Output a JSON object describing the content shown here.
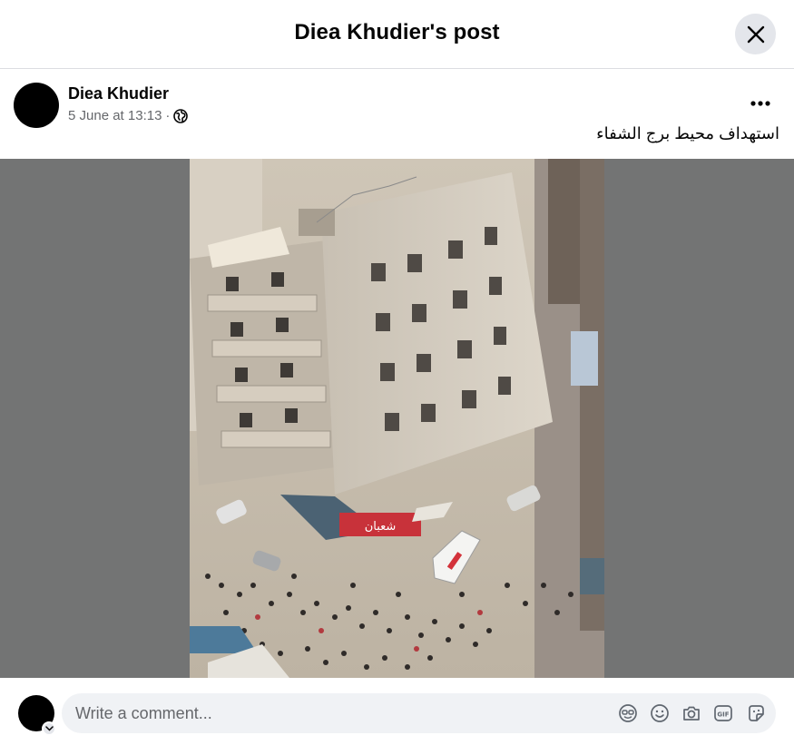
{
  "dialog": {
    "title": "Diea Khudier's post"
  },
  "post": {
    "author": "Diea Khudier",
    "timestamp": "5 June at 13:13",
    "separator": "·",
    "privacy_icon": "globe-icon",
    "caption": "استهداف محيط برج الشفاء",
    "more_icon": "more-options-icon"
  },
  "comment": {
    "placeholder": "Write a comment...",
    "icons": [
      "avatar-sticker-icon",
      "emoji-icon",
      "camera-icon",
      "gif-icon",
      "sticker-icon"
    ],
    "gif_text": "GIF"
  },
  "photo": {
    "sign_text": "شعبان"
  },
  "colors": {
    "header_divider": "#dcdde1",
    "close_button_bg": "#e4e6eb",
    "secondary_text": "#65676b",
    "media_backdrop": "#737474",
    "input_bg": "#f0f2f5"
  }
}
